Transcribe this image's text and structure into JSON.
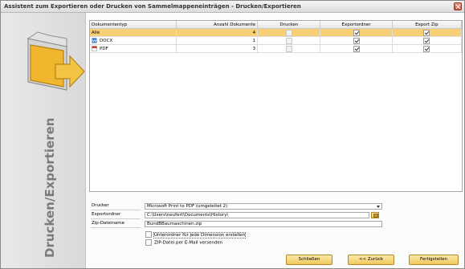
{
  "window": {
    "title": "Assistent zum Exportieren oder Drucken von Sammelmappeneinträgen - Drucken/Exportieren"
  },
  "sidebar": {
    "vertical_title": "Drucken/Exportieren",
    "icon": "folder-export-icon"
  },
  "grid": {
    "columns": [
      "Dokumententyp",
      "Anzahl Dokumente",
      "Drucken",
      "Exportordner",
      "Export Zip"
    ],
    "rows": [
      {
        "type": "Alle",
        "icon": "",
        "count": "4",
        "print": false,
        "export_folder": true,
        "export_zip": true,
        "selected": true
      },
      {
        "type": "DOCX",
        "icon": "word-file-icon",
        "count": "1",
        "print": false,
        "export_folder": true,
        "export_zip": true,
        "selected": false
      },
      {
        "type": "PDF",
        "icon": "pdf-file-icon",
        "count": "3",
        "print": false,
        "export_folder": true,
        "export_zip": true,
        "selected": false
      }
    ]
  },
  "form": {
    "printer_label": "Drucker",
    "printer_value": "Microsoft Print to PDF (umgeleitet 2)",
    "folder_label": "Exportordner",
    "folder_value": "C:\\Users\\neufert\\Documents\\History\\",
    "zip_label": "Zip-Dateiname",
    "zip_value": "BundBBaumaschinen.zip"
  },
  "options": {
    "subfolder_label": "Unterordner für jede Dimension erstellen",
    "subfolder_checked": false,
    "email_label": "ZIP-Datei per E-Mail versenden",
    "email_checked": false
  },
  "buttons": {
    "close": "Schließen",
    "back": "<< Zurück",
    "finish": "Fertigstellen"
  },
  "colors": {
    "selected_row": "#f7cf76",
    "button": "#f1c85d",
    "folder": "#f0b62d"
  }
}
